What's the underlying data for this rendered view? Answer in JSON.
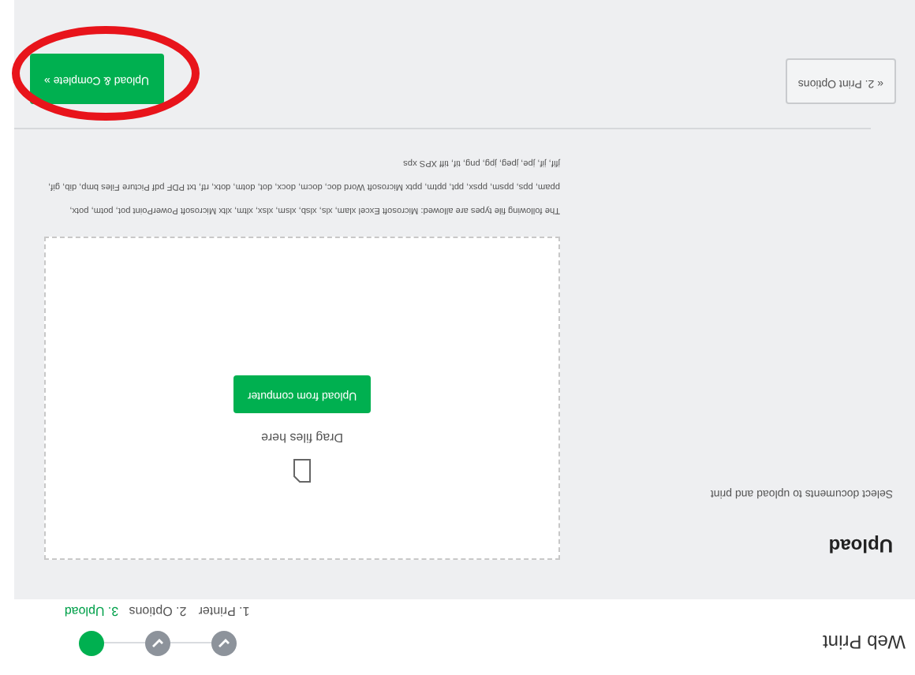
{
  "header": {
    "title": "Web Print"
  },
  "steps": [
    {
      "label": "1. Printer",
      "completed": true,
      "selected": false
    },
    {
      "label": "2. Options",
      "completed": true,
      "selected": false
    },
    {
      "label": "3. Upload",
      "completed": false,
      "selected": true
    }
  ],
  "section": {
    "title": "Upload",
    "subtitle": "Select documents to upload and print"
  },
  "dropzone": {
    "hint": "Drag files here",
    "button": "Upload from computer"
  },
  "allowed_types": "The following file types are allowed: Microsoft Excel xlam, xls, xlsb, xlsm, xlsx, xltm, xltx Microsoft PowerPoint pot, potm, potx, ppam, pps, ppsm, ppsx, ppt, pptm, pptx Microsoft Word doc, docm, docx, dot, dotm, dotx, rtf, txt PDF pdf Picture Files bmp, dib, gif, jfif, jif, jpe, jpeg, jpg, png, tif, tiff XPS xps",
  "footer": {
    "back_button": "« 2. Print Options",
    "next_button": "Upload & Complete »"
  },
  "annotation": {
    "kind": "ellipse",
    "color": "#e8141b"
  }
}
